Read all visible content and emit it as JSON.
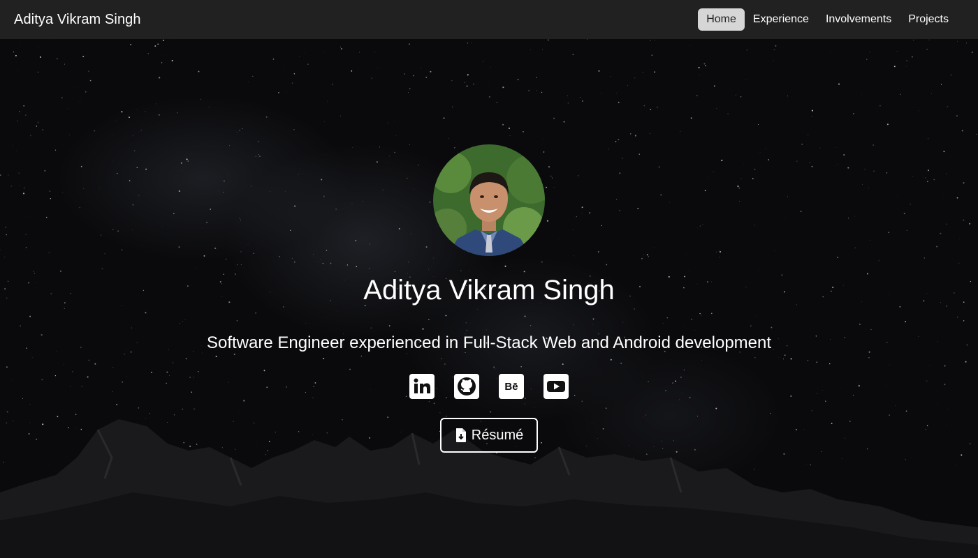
{
  "navbar": {
    "brand": "Aditya Vikram Singh",
    "links": [
      {
        "label": "Home",
        "active": true
      },
      {
        "label": "Experience",
        "active": false
      },
      {
        "label": "Involvements",
        "active": false
      },
      {
        "label": "Projects",
        "active": false
      }
    ]
  },
  "hero": {
    "name": "Aditya Vikram Singh",
    "tagline": "Software Engineer experienced in Full-Stack Web and Android development",
    "social_icons": [
      "linkedin-icon",
      "github-icon",
      "behance-icon",
      "youtube-icon"
    ],
    "resume_label": "Résumé",
    "resume_icon": "file-download-icon"
  },
  "colors": {
    "navbar_bg": "#212121",
    "active_link_bg": "#d6d6d6",
    "hero_bg": "#0a0a0c"
  }
}
